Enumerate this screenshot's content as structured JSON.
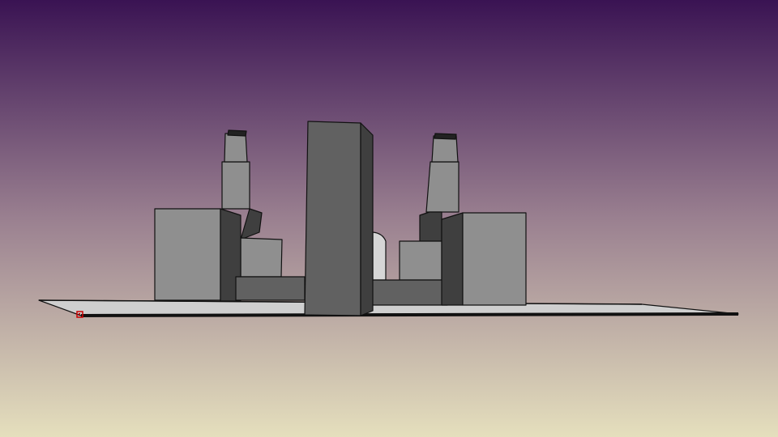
{
  "scene": {
    "sky_colors": {
      "top": "#3a1353",
      "middle": "#9a8090",
      "bottom": "#e5dfbd"
    },
    "building_colors": {
      "front": "#616161",
      "light": "#8f8f8f",
      "dark": "#3f3f3f",
      "outline": "#111111",
      "ground": "#cfcfcf"
    },
    "marker": {
      "name": "position-marker",
      "color": "#cc0000"
    }
  }
}
